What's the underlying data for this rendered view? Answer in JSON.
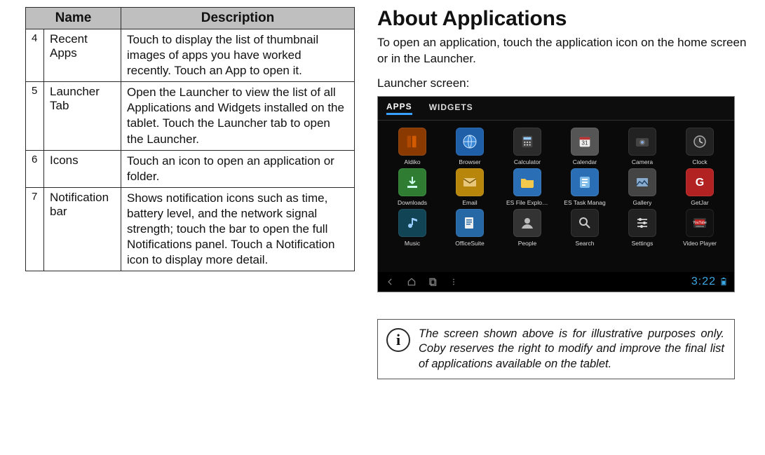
{
  "table": {
    "headers": {
      "name": "Name",
      "description": "Description"
    },
    "rows": [
      {
        "num": "4",
        "name": "Recent Apps",
        "desc": "Touch to display the list of thumbnail images of apps you have worked recently. Touch an App to open it."
      },
      {
        "num": "5",
        "name": "Launcher Tab",
        "desc": "Open the Launcher to view the list of all Applications and Widgets installed on the tablet. Touch the Launcher tab to open the Launcher."
      },
      {
        "num": "6",
        "name": "Icons",
        "desc": "Touch an icon to open an application or folder."
      },
      {
        "num": "7",
        "name": "Notification bar",
        "desc": "Shows notification icons such as time, battery level, and the network signal strength; touch the bar to open the full Notifications panel. Touch a Notification icon to display more detail."
      }
    ]
  },
  "heading": "About Applications",
  "intro": "To open an application, touch the application icon on the home screen or in the Launcher.",
  "launcher_label": "Launcher screen:",
  "device": {
    "tabs": {
      "apps": "APPS",
      "widgets": "WIDGETS"
    },
    "apps": [
      {
        "label": "Aldiko"
      },
      {
        "label": "Browser"
      },
      {
        "label": "Calculator"
      },
      {
        "label": "Calendar"
      },
      {
        "label": "Camera"
      },
      {
        "label": "Clock"
      },
      {
        "label": "Downloads"
      },
      {
        "label": "Email"
      },
      {
        "label": "ES File Explorer"
      },
      {
        "label": "ES Task Manag"
      },
      {
        "label": "Gallery"
      },
      {
        "label": "GetJar"
      },
      {
        "label": "Music"
      },
      {
        "label": "OfficeSuite"
      },
      {
        "label": "People"
      },
      {
        "label": "Search"
      },
      {
        "label": "Settings"
      },
      {
        "label": "Video Player"
      }
    ],
    "clock": "3:22"
  },
  "info_note": "The screen shown above is for illustrative purposes only. Coby reserves the right to modify  and improve the final list of applications available on the tablet."
}
